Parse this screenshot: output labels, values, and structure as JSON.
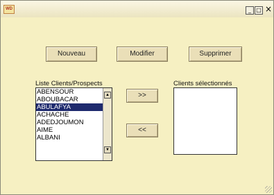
{
  "window": {
    "icon_label": "WD",
    "minimize_glyph": "_",
    "maximize_glyph": "□",
    "close_glyph": "×"
  },
  "toolbar": {
    "new_label": "Nouveau",
    "modify_label": "Modifier",
    "delete_label": "Supprimer"
  },
  "clients_list": {
    "label": "Liste Clients/Prospects",
    "items": [
      {
        "name": "ABENSOUR",
        "selected": false
      },
      {
        "name": "ABOUBACAR",
        "selected": false
      },
      {
        "name": "ABULAFYA",
        "selected": true
      },
      {
        "name": "ACHACHE",
        "selected": false
      },
      {
        "name": "ADEDJOUMON",
        "selected": false
      },
      {
        "name": "AIME",
        "selected": false
      },
      {
        "name": "ALBANI",
        "selected": false
      }
    ],
    "scroll_up_glyph": "▲",
    "scroll_down_glyph": "▼"
  },
  "transfer": {
    "add_label": ">>",
    "remove_label": "<<"
  },
  "selected_list": {
    "label": "Clients sélectionnés",
    "items": []
  },
  "colors": {
    "window_bg": "#f6f0c2",
    "button_bg": "#eadfb8",
    "selection_bg": "#1e2a6e"
  }
}
